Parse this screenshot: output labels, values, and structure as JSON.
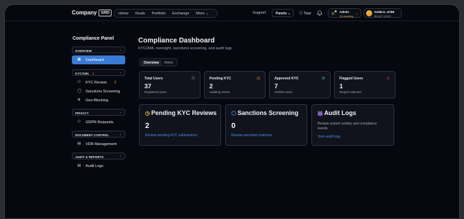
{
  "brand": {
    "name": "Company",
    "badge": "GRID"
  },
  "nav": {
    "items": [
      "Home",
      "Deals",
      "Portfolio",
      "Exchange",
      "More ⌄"
    ]
  },
  "topbar": {
    "support": "Support",
    "panels": "Panels ⌄",
    "tour": "Tour"
  },
  "admin": {
    "initial": "A",
    "name": "Admin",
    "pending": "10 pending",
    "caret": "⌄"
  },
  "wallet": {
    "address": "0xd5c3...5788",
    "balance": "$5,007 USDC"
  },
  "sidebar": {
    "title": "Compliance Panel",
    "overview": {
      "label": "OVERVIEW",
      "caret": "⌄",
      "dashboard": "Dashboard"
    },
    "kycaml": {
      "label": "KYC/AML",
      "count": "2",
      "caret": "⌄",
      "kyc_review": "KYC Review",
      "kyc_count": "2",
      "sanctions": "Sanctions Screening",
      "geo": "Geo-Blocking"
    },
    "privacy": {
      "label": "PRIVACY",
      "caret": "⌄",
      "gdpr": "GDPR Requests"
    },
    "document": {
      "label": "DOCUMENT CONTROL",
      "caret": "⌄",
      "vdr": "VDR Management"
    },
    "audit": {
      "label": "AUDIT & REPORTS",
      "caret": "⌄",
      "logs": "Audit Logs"
    }
  },
  "main": {
    "title": "Compliance Dashboard",
    "subtitle": "KYC/AML oversight, sanctions screening, and audit logs",
    "tabs": [
      "Overview",
      "Alerts"
    ]
  },
  "stats": [
    {
      "title": "Total Users",
      "value": "37",
      "sub": "Registered users",
      "icon": "users-icon",
      "color": "#c7cad3"
    },
    {
      "title": "Pending KYC",
      "value": "2",
      "sub": "Awaiting review",
      "icon": "clock-icon",
      "color": "#f5a623"
    },
    {
      "title": "Approved KYC",
      "value": "7",
      "sub": "Verified users",
      "icon": "check-circle-icon",
      "color": "#3ecf7a"
    },
    {
      "title": "Flagged Users",
      "value": "1",
      "sub": "Require attention",
      "icon": "warning-icon",
      "color": "#e05555"
    }
  ],
  "panels": {
    "pending": {
      "title": "Pending KYC Reviews",
      "value": "2",
      "link": "Review pending KYC submissions",
      "icon": "clock-icon",
      "color": "#f5b83d"
    },
    "sanctions": {
      "title": "Sanctions Screening",
      "value": "0",
      "link": "Review sanctions matches",
      "icon": "shield-icon",
      "color": "#4c8ff0"
    },
    "audit": {
      "title": "Audit Logs",
      "desc": "Review system activity and compliance events",
      "link": "View audit logs",
      "icon": "file-icon",
      "color": "#a67cf0"
    }
  }
}
